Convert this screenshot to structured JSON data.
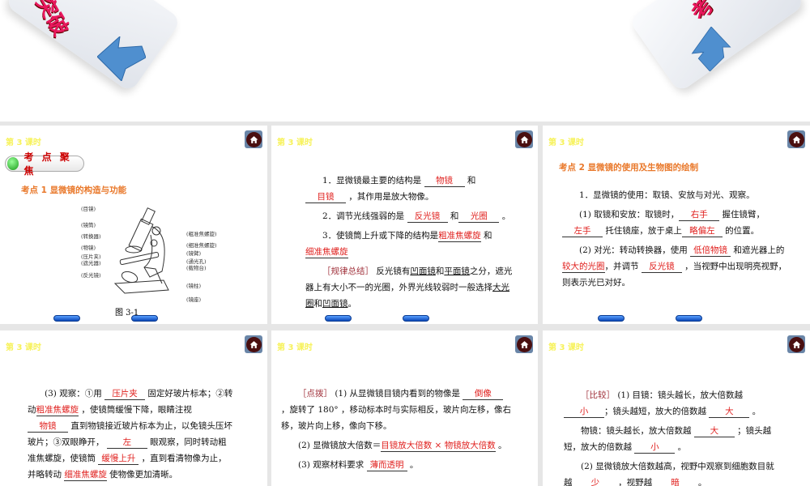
{
  "banner": {
    "left_text": "突破",
    "right_text": "考"
  },
  "lesson_label": "第 3 课时",
  "icons": {
    "home": "home-icon",
    "arrow": "arrow-icon"
  },
  "colors": {
    "answer": "#e0201e",
    "heading": "#e9782a",
    "title": "#f7f25a"
  },
  "panel1": {
    "badge": "考 点 聚 焦",
    "heading": "考点 1   显微镜的构造与功能",
    "left_labels": [
      "(目镜)",
      "(镜筒)",
      "(转换器)",
      "(物镜)",
      "(压片夹)",
      "(遮光器)",
      "(反光镜)"
    ],
    "right_labels": [
      "(粗准焦螺旋)",
      "(细准焦螺旋)",
      "(镜臂)",
      "(通光孔)",
      "(载物台)",
      "(镜柱)",
      "(镜座)"
    ],
    "caption": "图 3-1"
  },
  "panel2": {
    "paras": [
      [
        {
          "t": "1．显微镜最主要的结构是 "
        },
        {
          "a": "物镜"
        },
        {
          "t": " 和 "
        },
        {
          "a": "目镜"
        },
        {
          "t": " ，其作用是放大物像。"
        }
      ],
      [
        {
          "t": "2．调节光线强弱的是 "
        },
        {
          "a": "反光镜"
        },
        {
          "t": " 和"
        },
        {
          "a": "光圈"
        },
        {
          "t": " 。"
        }
      ],
      [
        {
          "t": "3．使镜筒上升或下降的结构是"
        },
        {
          "a": "粗准焦螺旋"
        },
        {
          "t": " 和 "
        },
        {
          "a": "细准焦螺旋"
        }
      ],
      [
        {
          "k": "［规律总结］"
        },
        {
          "t": " 反光镜有"
        },
        {
          "u": "凹面镜"
        },
        {
          "t": "和"
        },
        {
          "u": "平面镜"
        },
        {
          "t": "之分，遮光器上有大小不一的光圈，外界光线较弱时一般选择"
        },
        {
          "u": "大光圈"
        },
        {
          "t": "和"
        },
        {
          "u": "凹面镜"
        },
        {
          "t": "。"
        }
      ]
    ]
  },
  "panel3": {
    "heading": "考点 2    显微镜的使用及生物图的绘制",
    "paras": [
      [
        {
          "t": "1．显微镜的使用：取镜、安放与对光、观察。"
        }
      ],
      [
        {
          "t": "(1) 取镜和安放：取镜时，"
        },
        {
          "a": "右手"
        },
        {
          "t": " 握住镜臂，"
        },
        {
          "a": "左手"
        },
        {
          "t": " 托住镜座，放于桌上"
        },
        {
          "a": "略偏左"
        },
        {
          "t": " 的位置。"
        }
      ],
      [
        {
          "t": "(2) 对光：转动转换器，使用 "
        },
        {
          "a": "低倍物镜"
        },
        {
          "t": " 和遮光器上的 "
        },
        {
          "a": "较大的光圈"
        },
        {
          "t": "，并调节 "
        },
        {
          "a": "反光镜"
        },
        {
          "t": " ，当视野中出现明亮视野，则表示光已对好。"
        }
      ]
    ]
  },
  "panel4": {
    "paras": [
      [
        {
          "t": "(3) 观察：①用 "
        },
        {
          "a": "压片夹"
        },
        {
          "t": " 固定好玻片标本；②转动"
        },
        {
          "a": "粗准焦螺旋"
        },
        {
          "t": " ，使镜筒缓慢下降，眼睛注视 "
        },
        {
          "a": "物镜"
        },
        {
          "t": " 直到物镜接近玻片标本为止，以免镜头压坏玻片；③双眼睁开， "
        },
        {
          "a": "左"
        },
        {
          "t": " 眼观察，同时转动粗准焦螺旋，使镜筒 "
        },
        {
          "a": "缓慢上升"
        },
        {
          "t": " ，直到看清物像为止，并略转动 "
        },
        {
          "a": "细准焦螺旋"
        },
        {
          "t": " 使物像更加清晰。"
        }
      ]
    ]
  },
  "panel5": {
    "paras": [
      [
        {
          "k": "［点拨］"
        },
        {
          "t": " (1) 从显微镜目镜内看到的物像是 "
        },
        {
          "a": "倒像"
        },
        {
          "t": " ，旋转了 180° ，移动标本时与实际相反，玻片向左移，像右移，玻片向上移，像向下移。"
        }
      ],
      [
        {
          "t": "(2) 显微镜放大倍数＝"
        },
        {
          "a": "目镜放大倍数 × 物镜放大倍数"
        },
        {
          "t": " 。"
        }
      ],
      [
        {
          "t": "(3) 观察材料要求 "
        },
        {
          "a": "薄而透明"
        },
        {
          "t": " 。"
        }
      ]
    ]
  },
  "panel6": {
    "paras": [
      [
        {
          "k": "［比较］"
        },
        {
          "t": " (1) 目镜：镜头越长，放大倍数越 "
        },
        {
          "a": "小"
        },
        {
          "t": "；镜头越短，放大的倍数越 "
        },
        {
          "a": "大"
        },
        {
          "t": " 。"
        }
      ],
      [
        {
          "t": "物镜：镜头越长，放大倍数越 "
        },
        {
          "a": "大"
        },
        {
          "t": " ；镜头越短，放大的倍数越 "
        },
        {
          "a": "小"
        },
        {
          "t": " 。"
        }
      ],
      [
        {
          "t": "(2) 显微镜放大倍数越高，视野中观察到细胞数目就越 "
        },
        {
          "a": "少"
        },
        {
          "t": " ，视野越 "
        },
        {
          "a": "暗"
        },
        {
          "t": " 。"
        }
      ]
    ]
  }
}
